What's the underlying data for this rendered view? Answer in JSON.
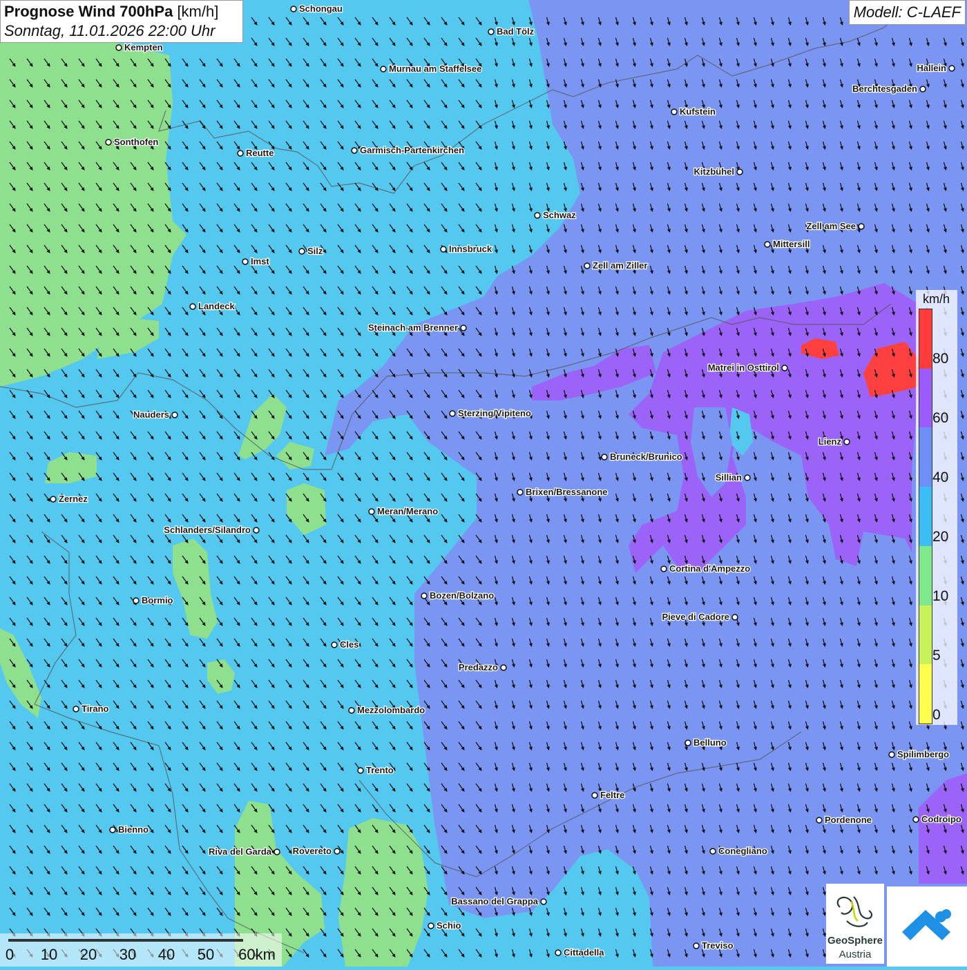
{
  "title": {
    "main": "Prognose Wind 700hPa",
    "unit": "[km/h]",
    "datetime": "Sonntag, 11.01.2026 22:00 Uhr"
  },
  "model": "Modell: C-LAEF",
  "legend": {
    "unit": "km/h",
    "ticks": [
      "80",
      "60",
      "40",
      "20",
      "10",
      "5",
      "0"
    ],
    "colors": [
      "#ff3b3b",
      "#9b5cff",
      "#6e8ff5",
      "#3bbdf5",
      "#7fe88a",
      "#c9f25a",
      "#ffff4d"
    ]
  },
  "scalebar": {
    "labels": [
      "0",
      "10",
      "20",
      "30",
      "40",
      "50",
      "60km"
    ]
  },
  "logos": {
    "geosphere_line1": "GeoSphere",
    "geosphere_line2": "Austria"
  },
  "cities": [
    {
      "name": "Schongau"
    },
    {
      "name": "Bad Tölz"
    },
    {
      "name": "Kempten"
    },
    {
      "name": "Murnau am Staffelsee"
    },
    {
      "name": "Hallein"
    },
    {
      "name": "Berchtesgaden"
    },
    {
      "name": "Kufstein"
    },
    {
      "name": "Sonthofen"
    },
    {
      "name": "Reutte"
    },
    {
      "name": "Garmisch-Partenkirchen"
    },
    {
      "name": "Kitzbühel"
    },
    {
      "name": "Schwaz"
    },
    {
      "name": "Zell am See"
    },
    {
      "name": "Mittersill"
    },
    {
      "name": "Innsbruck"
    },
    {
      "name": "Silz"
    },
    {
      "name": "Imst"
    },
    {
      "name": "Zell am Ziller"
    },
    {
      "name": "Landeck"
    },
    {
      "name": "Steinach am Brenner"
    },
    {
      "name": "Matrei in Osttirol"
    },
    {
      "name": "Nauders"
    },
    {
      "name": "Sterzing/Vipiteno"
    },
    {
      "name": "Lienz"
    },
    {
      "name": "Bruneck/Brunico"
    },
    {
      "name": "Sillian"
    },
    {
      "name": "Zernez"
    },
    {
      "name": "Brixen/Bressanone"
    },
    {
      "name": "Meran/Merano"
    },
    {
      "name": "Schlanders/Silandro"
    },
    {
      "name": "Cortina d'Ampezzo"
    },
    {
      "name": "Bormio"
    },
    {
      "name": "Bozen/Bolzano"
    },
    {
      "name": "Pieve di Cadore"
    },
    {
      "name": "Cles"
    },
    {
      "name": "Predazzo"
    },
    {
      "name": "Tirano"
    },
    {
      "name": "Mezzolombardo"
    },
    {
      "name": "Belluno"
    },
    {
      "name": "Spilimbergo"
    },
    {
      "name": "Trento"
    },
    {
      "name": "Feltre"
    },
    {
      "name": "Bienno"
    },
    {
      "name": "Pordenone"
    },
    {
      "name": "Codroipo"
    },
    {
      "name": "Riva del Garda"
    },
    {
      "name": "Rovereto"
    },
    {
      "name": "Conegliano"
    },
    {
      "name": "Bassano del Grappa"
    },
    {
      "name": "Schio"
    },
    {
      "name": "Treviso"
    },
    {
      "name": "Cittadella"
    }
  ]
}
